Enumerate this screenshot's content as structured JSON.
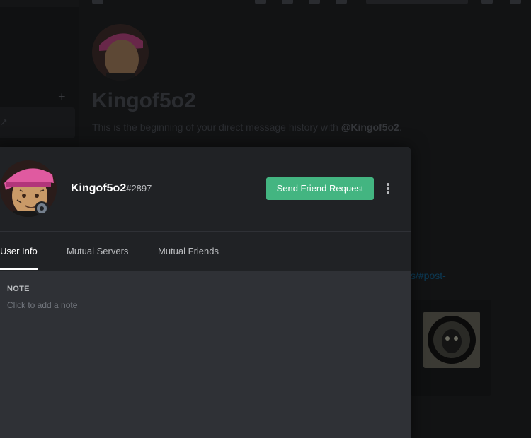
{
  "background": {
    "title": "Kingof5o2",
    "intro_text": "This is the beginning of your direct message history with ",
    "intro_mention": "@Kingof5o2",
    "intro_end": ".",
    "link_fragment": "s/#post-"
  },
  "profile": {
    "username": "Kingof5o2",
    "discriminator": "#2897",
    "status": "offline",
    "send_friend_request_label": "Send Friend Request",
    "tabs": [
      {
        "label": "User Info",
        "active": true
      },
      {
        "label": "Mutual Servers",
        "active": false
      },
      {
        "label": "Mutual Friends",
        "active": false
      }
    ],
    "note_heading": "NOTE",
    "note_placeholder": "Click to add a note"
  },
  "colors": {
    "accent_green": "#43b581",
    "modal_header": "#202225",
    "modal_body": "#2f3136",
    "status_offline": "#747f8d"
  }
}
